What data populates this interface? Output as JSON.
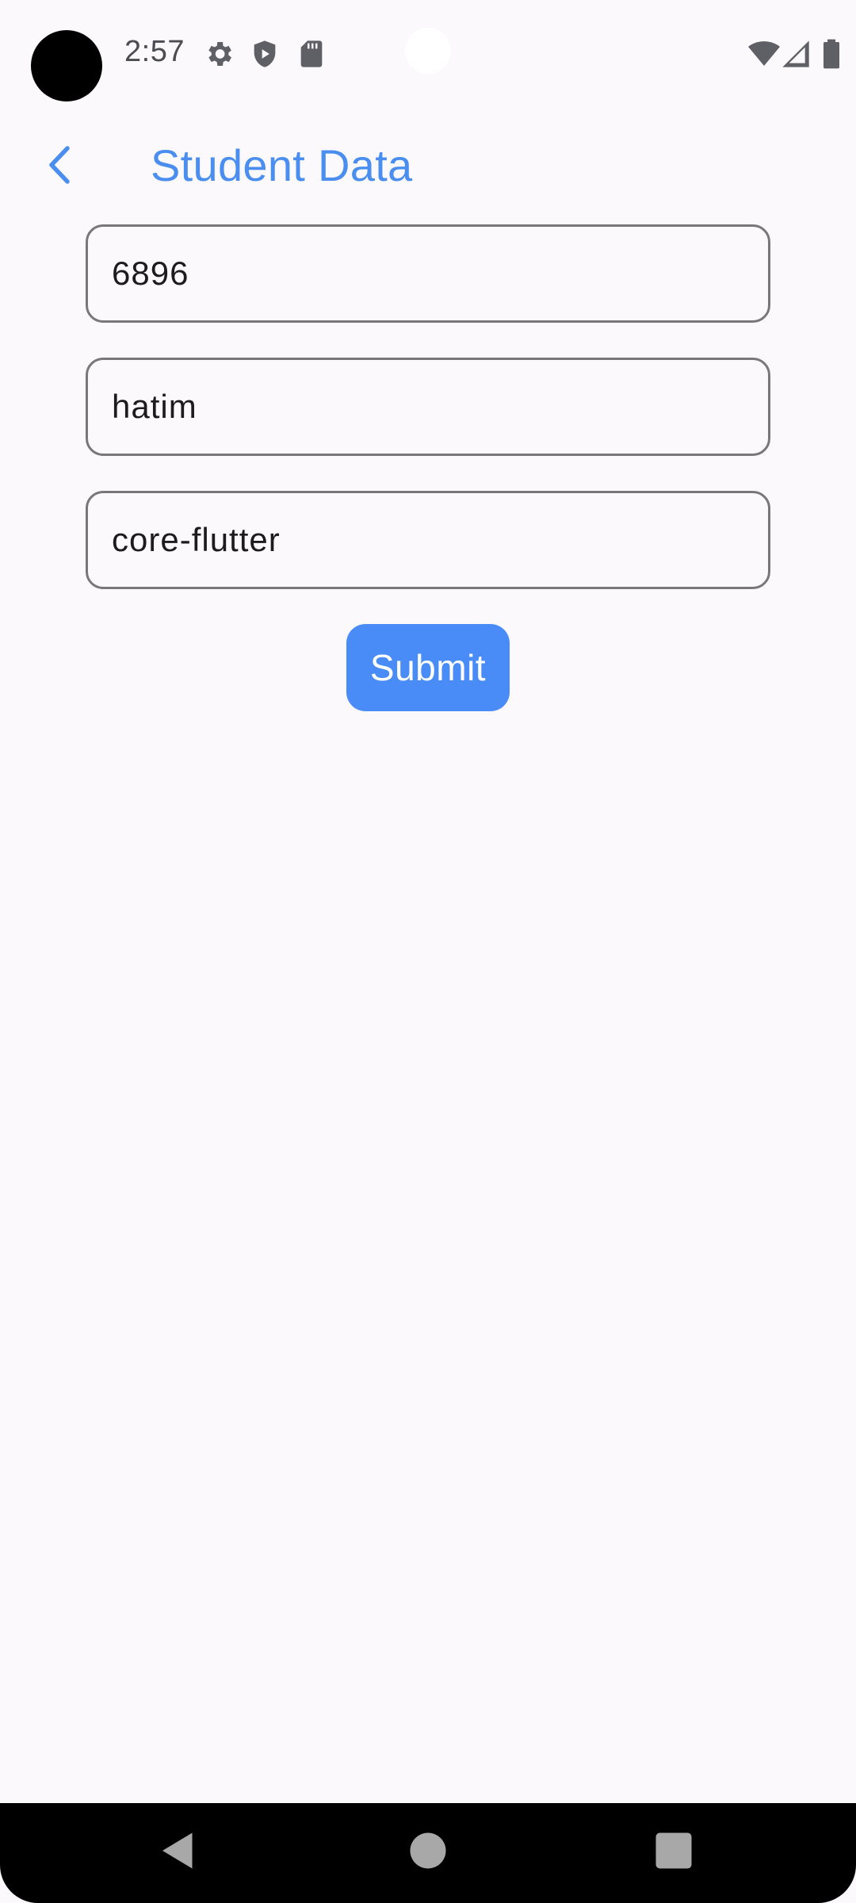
{
  "status_bar": {
    "time": "2:57",
    "left_icons": [
      "gear-icon",
      "shield-play-icon",
      "sd-card-icon"
    ],
    "right_icons": [
      "wifi-icon",
      "cell-signal-icon",
      "battery-icon"
    ]
  },
  "app_bar": {
    "title": "Student Data",
    "back_icon": "chevron-left-icon",
    "accent_color": "#4a8ef0"
  },
  "form": {
    "fields": [
      {
        "value": "6896"
      },
      {
        "value": "hatim"
      },
      {
        "value": "core-flutter"
      }
    ],
    "submit_label": "Submit",
    "submit_color": "#4a8cf7"
  },
  "nav_bar": {
    "buttons": [
      "back-triangle-icon",
      "home-circle-icon",
      "recents-square-icon"
    ]
  }
}
